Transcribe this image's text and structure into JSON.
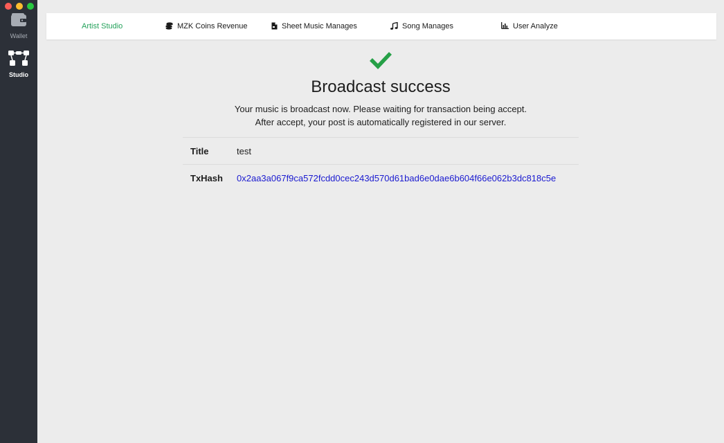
{
  "sidebar": {
    "items": [
      {
        "label": "Wallet",
        "icon": "wallet-icon"
      },
      {
        "label": "Studio",
        "icon": "studio-icon"
      }
    ]
  },
  "nav": {
    "items": [
      {
        "label": "Artist Studio",
        "icon": "",
        "active": true
      },
      {
        "label": "MZK Coins Revenue",
        "icon": "coins-icon"
      },
      {
        "label": "Sheet Music Manages",
        "icon": "file-icon"
      },
      {
        "label": "Song Manages",
        "icon": "music-note-icon"
      },
      {
        "label": "User Analyze",
        "icon": "bar-chart-icon"
      }
    ]
  },
  "main": {
    "title": "Broadcast success",
    "message_line1": "Your music is broadcast now. Please waiting for transaction being accept.",
    "message_line2": "After accept, your post is automatically registered in our server.",
    "details": {
      "title_label": "Title",
      "title_value": "test",
      "txhash_label": "TxHash",
      "txhash_value": "0x2aa3a067f9ca572fcdd0cec243d570d61bad6e0dae6b604f66e062b3dc818c5e"
    }
  },
  "colors": {
    "accent": "#23a15a",
    "link": "#1a1ad0",
    "sidebar_bg": "#2c3038",
    "page_bg": "#ececec",
    "check": "#26a047"
  }
}
